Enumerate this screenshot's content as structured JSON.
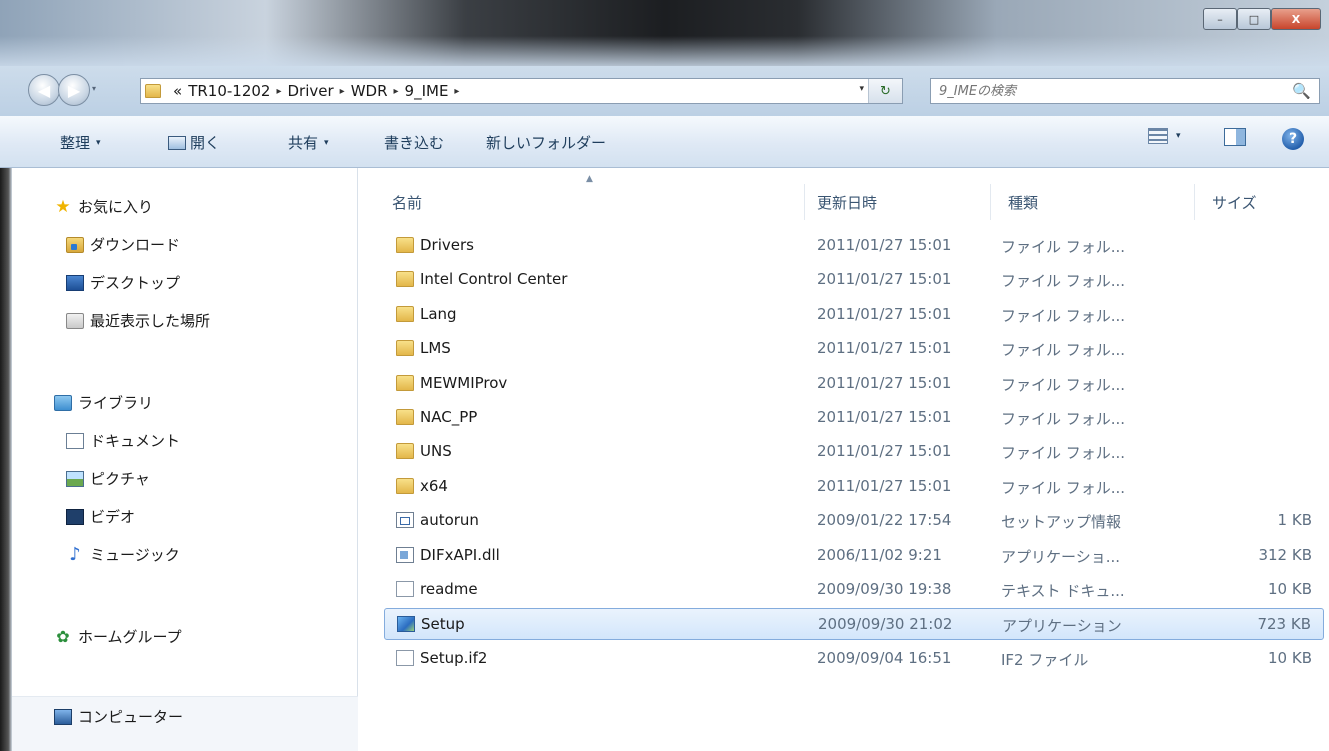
{
  "window": {
    "controls": {
      "minimize": "–",
      "maximize": "□",
      "close": "X"
    }
  },
  "nav": {
    "back_icon": "◀",
    "forward_icon": "▶",
    "dropdown_icon": "▾"
  },
  "address": {
    "prefix": "«",
    "crumbs": [
      "TR10-1202",
      "Driver",
      "WDR",
      "9_IME"
    ],
    "separator": "▸",
    "dropdown_icon": "▾",
    "refresh_icon": "↻"
  },
  "search": {
    "placeholder": "9_IMEの検索",
    "icon": "🔍"
  },
  "toolbar": {
    "organize": "整理",
    "open": "開く",
    "share": "共有",
    "burn": "書き込む",
    "new_folder": "新しいフォルダー",
    "arrow": "▾",
    "help": "?"
  },
  "sidebar": {
    "favorites_title": "お気に入り",
    "favorites": [
      "ダウンロード",
      "デスクトップ",
      "最近表示した場所"
    ],
    "libraries_title": "ライブラリ",
    "libraries": [
      "ドキュメント",
      "ピクチャ",
      "ビデオ",
      "ミュージック"
    ],
    "homegroup": "ホームグループ",
    "computer": "コンピューター"
  },
  "columns": {
    "name": "名前",
    "date": "更新日時",
    "type": "種類",
    "size": "サイズ",
    "sort_icon": "▲"
  },
  "files": [
    {
      "name": "Drivers",
      "date": "2011/01/27 15:01",
      "type": "ファイル フォル...",
      "size": "",
      "icon": "folder"
    },
    {
      "name": "Intel Control Center",
      "date": "2011/01/27 15:01",
      "type": "ファイル フォル...",
      "size": "",
      "icon": "folder"
    },
    {
      "name": "Lang",
      "date": "2011/01/27 15:01",
      "type": "ファイル フォル...",
      "size": "",
      "icon": "folder"
    },
    {
      "name": "LMS",
      "date": "2011/01/27 15:01",
      "type": "ファイル フォル...",
      "size": "",
      "icon": "folder"
    },
    {
      "name": "MEWMIProv",
      "date": "2011/01/27 15:01",
      "type": "ファイル フォル...",
      "size": "",
      "icon": "folder"
    },
    {
      "name": "NAC_PP",
      "date": "2011/01/27 15:01",
      "type": "ファイル フォル...",
      "size": "",
      "icon": "folder"
    },
    {
      "name": "UNS",
      "date": "2011/01/27 15:01",
      "type": "ファイル フォル...",
      "size": "",
      "icon": "folder"
    },
    {
      "name": "x64",
      "date": "2011/01/27 15:01",
      "type": "ファイル フォル...",
      "size": "",
      "icon": "folder"
    },
    {
      "name": "autorun",
      "date": "2009/01/22 17:54",
      "type": "セットアップ情報",
      "size": "1 KB",
      "icon": "inf"
    },
    {
      "name": "DIFxAPI.dll",
      "date": "2006/11/02 9:21",
      "type": "アプリケーショ...",
      "size": "312 KB",
      "icon": "dll"
    },
    {
      "name": "readme",
      "date": "2009/09/30 19:38",
      "type": "テキスト ドキュ...",
      "size": "10 KB",
      "icon": "txt"
    },
    {
      "name": "Setup",
      "date": "2009/09/30 21:02",
      "type": "アプリケーション",
      "size": "723 KB",
      "icon": "exe",
      "selected": true
    },
    {
      "name": "Setup.if2",
      "date": "2009/09/04 16:51",
      "type": "IF2 ファイル",
      "size": "10 KB",
      "icon": "txt"
    }
  ]
}
